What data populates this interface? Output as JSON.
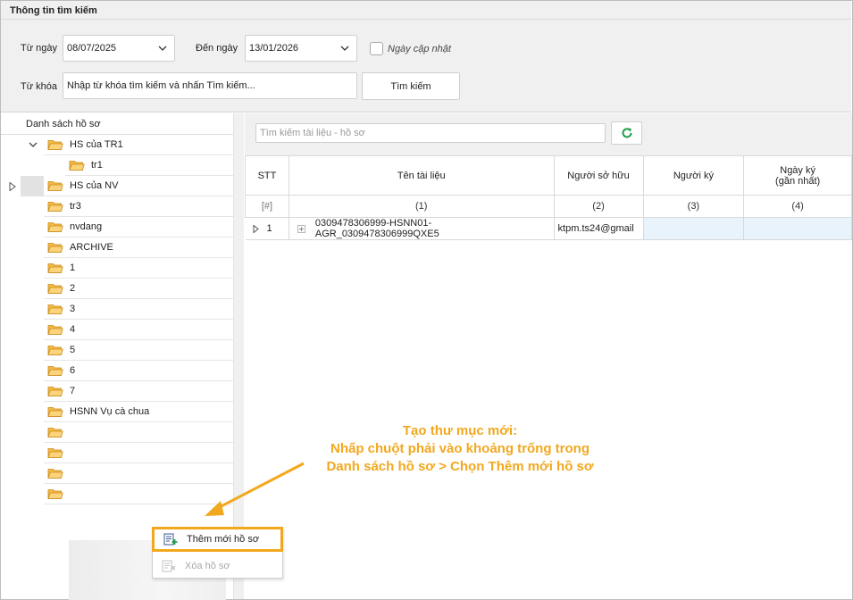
{
  "search_panel": {
    "title": "Thông tin tìm kiếm",
    "from_date_label": "Từ ngày",
    "from_date_value": "08/07/2025",
    "to_date_label": "Đến ngày",
    "to_date_value": "13/01/2026",
    "updated_date_label": "Ngày cập nhật",
    "keyword_label": "Từ khóa",
    "keyword_placeholder": "Nhập từ khóa tìm kiếm và nhấn Tìm kiếm...",
    "search_button": "Tìm kiếm"
  },
  "tree": {
    "header": "Danh sách hồ sơ",
    "items": [
      {
        "label": "HS của TR1",
        "expanded": true
      },
      {
        "label": "tr1",
        "child": true
      },
      {
        "label": "HS của NV",
        "selected": true
      },
      {
        "label": "tr3"
      },
      {
        "label": "nvdang"
      },
      {
        "label": "ARCHIVE"
      },
      {
        "label": "1"
      },
      {
        "label": "2"
      },
      {
        "label": "3"
      },
      {
        "label": "4"
      },
      {
        "label": "5"
      },
      {
        "label": "6"
      },
      {
        "label": "7"
      },
      {
        "label": "HSNN Vụ cà chua"
      }
    ]
  },
  "grid": {
    "search_placeholder": "Tìm kiếm tài liệu - hồ sơ",
    "columns": [
      {
        "label": "STT",
        "sub": "[#]"
      },
      {
        "label": "Tên tài liệu",
        "sub": "(1)"
      },
      {
        "label": "Người sở hữu",
        "sub": "(2)"
      },
      {
        "label": "Người ký",
        "sub": "(3)"
      },
      {
        "label": "Ngày ký",
        "label2": "(gần nhất)",
        "sub": "(4)"
      }
    ],
    "rows": [
      {
        "stt": "1",
        "name": "0309478306999-HSNN01-AGR_0309478306999QXE5",
        "owner": "ktpm.ts24@gmail",
        "signer": "",
        "date": ""
      }
    ]
  },
  "context_menu": {
    "add_label": "Thêm mới hồ sơ",
    "delete_label": "Xóa hồ sơ"
  },
  "annotation": {
    "line1": "Tạo thư mục mới:",
    "line2": "Nhấp chuột phải vào khoảng trống trong",
    "line3": "Danh sách hồ sơ > Chọn Thêm mới hồ sơ"
  },
  "colors": {
    "accent": "#f2a81e",
    "folder": "#f5b944",
    "refresh": "#1e9e4a",
    "row_highlight": "#e8f3fc"
  }
}
